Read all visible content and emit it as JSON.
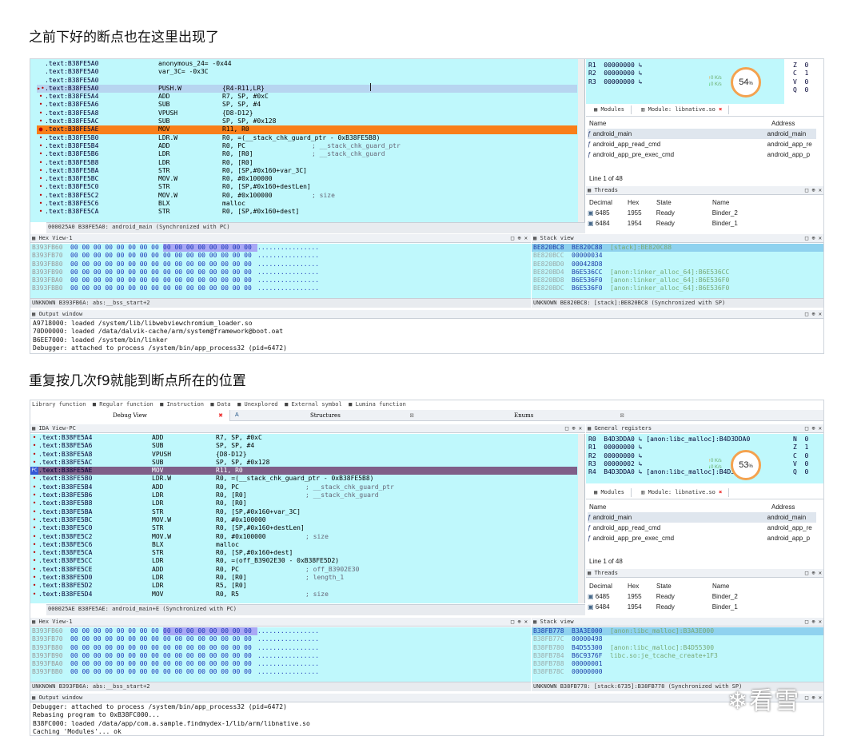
{
  "heading1": "之前下好的断点也在这里出现了",
  "heading2": "重复按几次f9就能到断点所在的位置",
  "watermark": "看雪",
  "shot1": {
    "ida_rows": [
      {
        "m": "",
        "a": ".text:B38FE5A0",
        "op": "anonymous_24= -0x44",
        "arg": "",
        "cm": "",
        "hl": ""
      },
      {
        "m": "",
        "a": ".text:B38FE5A0",
        "op": "var_3C= -0x3C",
        "arg": "",
        "cm": "",
        "hl": ""
      },
      {
        "m": "",
        "a": ".text:B38FE5A0",
        "op": "",
        "arg": "",
        "cm": "",
        "hl": ""
      },
      {
        "m": "▸•",
        "a": ".text:B38FE5A0",
        "op": "PUSH.W",
        "arg": "{R4-R11,LR}",
        "cm": "",
        "hl": "blue"
      },
      {
        "m": "•",
        "a": ".text:B38FE5A4",
        "op": "ADD",
        "arg": "R7, SP, #0xC",
        "cm": "",
        "hl": ""
      },
      {
        "m": "•",
        "a": ".text:B38FE5A6",
        "op": "SUB",
        "arg": "SP, SP, #4",
        "cm": "",
        "hl": ""
      },
      {
        "m": "•",
        "a": ".text:B38FE5A8",
        "op": "VPUSH",
        "arg": "{D8-D12}",
        "cm": "",
        "hl": ""
      },
      {
        "m": "•",
        "a": ".text:B38FE5AC",
        "op": "SUB",
        "arg": "SP, SP, #0x128",
        "cm": "",
        "hl": ""
      },
      {
        "m": "●",
        "a": ".text:B38FE5AE",
        "op": "MOV",
        "arg": "R11, R0",
        "cm": "",
        "hl": "orange"
      },
      {
        "m": "•",
        "a": ".text:B38FE5B0",
        "op": "LDR.W",
        "arg": "R0, =(__stack_chk_guard_ptr - 0xB38FE5B8)",
        "cm": "",
        "hl": ""
      },
      {
        "m": "•",
        "a": ".text:B38FE5B4",
        "op": "ADD",
        "arg": "R0, PC",
        "cm": "; __stack_chk_guard_ptr",
        "hl": ""
      },
      {
        "m": "•",
        "a": ".text:B38FE5B6",
        "op": "LDR",
        "arg": "R0, [R0]",
        "cm": "; __stack_chk_guard",
        "hl": ""
      },
      {
        "m": "•",
        "a": ".text:B38FE5B8",
        "op": "LDR",
        "arg": "R0, [R0]",
        "cm": "",
        "hl": ""
      },
      {
        "m": "•",
        "a": ".text:B38FE5BA",
        "op": "STR",
        "arg": "R0, [SP,#0x160+var_3C]",
        "cm": "",
        "hl": ""
      },
      {
        "m": "•",
        "a": ".text:B38FE5BC",
        "op": "MOV.W",
        "arg": "R0, #0x100000",
        "cm": "",
        "hl": ""
      },
      {
        "m": "•",
        "a": ".text:B38FE5C0",
        "op": "STR",
        "arg": "R0, [SP,#0x160+destLen]",
        "cm": "",
        "hl": ""
      },
      {
        "m": "•",
        "a": ".text:B38FE5C2",
        "op": "MOV.W",
        "arg": "R0, #0x100000",
        "cm": "; size",
        "hl": ""
      },
      {
        "m": "•",
        "a": ".text:B38FE5C6",
        "op": "BLX",
        "arg": "malloc",
        "cm": "",
        "hl": ""
      },
      {
        "m": "•",
        "a": ".text:B38FE5CA",
        "op": "STR",
        "arg": "R0, [SP,#0x160+dest]",
        "cm": "",
        "hl": ""
      }
    ],
    "ida_status": "000025A0 B38FE5A0: android_main (Synchronized with PC)",
    "regs": [
      "R1  00000000 ↳",
      "R2  00000000 ↳",
      "R3  00000000 ↳"
    ],
    "flags": [
      "Z  0",
      "C  1",
      "V  0",
      "Q  0"
    ],
    "gauge": "54",
    "gauge_unit": "%",
    "speed_up": "0 K/s",
    "speed_down": "0 K/s",
    "tabs": [
      "Modules",
      "Module: libnative.so"
    ],
    "mod_headers": [
      "Name",
      "Address"
    ],
    "mod_rows": [
      [
        "android_main",
        "android_main"
      ],
      [
        "android_app_read_cmd",
        "android_app_re"
      ],
      [
        "android_app_pre_exec_cmd",
        "android_app_p"
      ]
    ],
    "line_info": "Line 1 of 48",
    "threads_title": "Threads",
    "thr_headers": [
      "Decimal",
      "Hex",
      "State",
      "Name"
    ],
    "thr_rows": [
      [
        "6485",
        "1955",
        "Ready",
        "Binder_2"
      ],
      [
        "6484",
        "1954",
        "Ready",
        "Binder_1"
      ]
    ],
    "hex_title": "Hex View-1",
    "hex_rows": [
      {
        "addr": "B393FB60",
        "a": "00 00 00 00 00 00 00 00",
        "b": "00 00 00 00 00 00 00 00",
        "s": "................"
      },
      {
        "addr": "B393FB70",
        "a": "00 00 00 00 00 00 00 00",
        "b": "00 00 00 00 00 00 00 00",
        "s": "................"
      },
      {
        "addr": "B393FB80",
        "a": "00 00 00 00 00 00 00 00",
        "b": "00 00 00 00 00 00 00 00",
        "s": "................"
      },
      {
        "addr": "B393FB90",
        "a": "00 00 00 00 00 00 00 00",
        "b": "00 00 00 00 00 00 00 00",
        "s": "................"
      },
      {
        "addr": "B393FBA0",
        "a": "00 00 00 00 00 00 00 00",
        "b": "00 00 00 00 00 00 00 00",
        "s": "................"
      },
      {
        "addr": "B393FBB0",
        "a": "00 00 00 00 00 00 00 00",
        "b": "00 00 00 00 00 00 00 00",
        "s": "................"
      }
    ],
    "hex_status": "UNKNOWN B393FB6A: abs:__bss_start+2",
    "stack_title": "Stack view",
    "stack_rows": [
      {
        "a": "BE820BC8",
        "v": "BE820C88",
        "c": "[stack]:BE820C88",
        "sel": true
      },
      {
        "a": "BE820BCC",
        "v": "00000034",
        "c": "",
        "sel": false
      },
      {
        "a": "BE820BD0",
        "v": "000428D8",
        "c": "",
        "sel": false
      },
      {
        "a": "BE820BD4",
        "v": "B6E536CC",
        "c": "[anon:linker_alloc_64]:B6E536CC",
        "sel": false
      },
      {
        "a": "BE820BD8",
        "v": "B6E536F0",
        "c": "[anon:linker_alloc_64]:B6E536F0",
        "sel": false
      },
      {
        "a": "BE820BDC",
        "v": "B6E536F0",
        "c": "[anon:linker_alloc_64]:B6E536F0",
        "sel": false
      }
    ],
    "stack_status": "UNKNOWN BE820BC8: [stack]:BE820BC8 (Synchronized with SP)",
    "output_title": "Output window",
    "output_lines": [
      "A9718000: loaded /system/lib/libwebviewchromium_loader.so",
      "70D00000: loaded /data/dalvik-cache/arm/system@framework@boot.oat",
      "B6EE7000: loaded /system/bin/linker",
      "Debugger: attached to process /system/bin/app_process32 (pid=6472)"
    ]
  },
  "shot2": {
    "legend": "Library function  ■ Regular function  ■ Instruction  ■ Data  ■ Unexplored  ■ External symbol  ■ Lumina function",
    "top_tabs": [
      "Debug View",
      "A",
      "Structures",
      "Enums"
    ],
    "ida_title": "IDA View-PC",
    "ida_rows": [
      {
        "m": "•",
        "a": ".text:B38FE5A4",
        "op": "ADD",
        "arg": "R7, SP, #0xC",
        "cm": "",
        "hl": ""
      },
      {
        "m": "•",
        "a": ".text:B38FE5A6",
        "op": "SUB",
        "arg": "SP, SP, #4",
        "cm": "",
        "hl": ""
      },
      {
        "m": "•",
        "a": ".text:B38FE5A8",
        "op": "VPUSH",
        "arg": "{D8-D12}",
        "cm": "",
        "hl": ""
      },
      {
        "m": "•",
        "a": ".text:B38FE5AC",
        "op": "SUB",
        "arg": "SP, SP, #0x128",
        "cm": "",
        "hl": ""
      },
      {
        "m": "PC",
        "a": ".text:B38FE5AE",
        "op": "MOV",
        "arg": "R11, R0",
        "cm": "",
        "hl": "purple"
      },
      {
        "m": "•",
        "a": ".text:B38FE5B0",
        "op": "LDR.W",
        "arg": "R0, =(__stack_chk_guard_ptr - 0xB38FE5B8)",
        "cm": "",
        "hl": ""
      },
      {
        "m": "•",
        "a": ".text:B38FE5B4",
        "op": "ADD",
        "arg": "R0, PC",
        "cm": "; __stack_chk_guard_ptr",
        "hl": ""
      },
      {
        "m": "•",
        "a": ".text:B38FE5B6",
        "op": "LDR",
        "arg": "R0, [R0]",
        "cm": "; __stack_chk_guard",
        "hl": ""
      },
      {
        "m": "•",
        "a": ".text:B38FE5B8",
        "op": "LDR",
        "arg": "R0, [R0]",
        "cm": "",
        "hl": ""
      },
      {
        "m": "•",
        "a": ".text:B38FE5BA",
        "op": "STR",
        "arg": "R0, [SP,#0x160+var_3C]",
        "cm": "",
        "hl": ""
      },
      {
        "m": "•",
        "a": ".text:B38FE5BC",
        "op": "MOV.W",
        "arg": "R0, #0x100000",
        "cm": "",
        "hl": ""
      },
      {
        "m": "•",
        "a": ".text:B38FE5C0",
        "op": "STR",
        "arg": "R0, [SP,#0x160+destLen]",
        "cm": "",
        "hl": ""
      },
      {
        "m": "•",
        "a": ".text:B38FE5C2",
        "op": "MOV.W",
        "arg": "R0, #0x100000",
        "cm": "; size",
        "hl": ""
      },
      {
        "m": "•",
        "a": ".text:B38FE5C6",
        "op": "BLX",
        "arg": "malloc",
        "cm": "",
        "hl": ""
      },
      {
        "m": "•",
        "a": ".text:B38FE5CA",
        "op": "STR",
        "arg": "R0, [SP,#0x160+dest]",
        "cm": "",
        "hl": ""
      },
      {
        "m": "•",
        "a": ".text:B38FE5CC",
        "op": "LDR",
        "arg": "R0, =(off_B3902E30 - 0xB38FE5D2)",
        "cm": "",
        "hl": ""
      },
      {
        "m": "•",
        "a": ".text:B38FE5CE",
        "op": "ADD",
        "arg": "R0, PC",
        "cm": "; off_B3902E30",
        "hl": ""
      },
      {
        "m": "•",
        "a": ".text:B38FE5D0",
        "op": "LDR",
        "arg": "R0, [R0]",
        "cm": "; length_1",
        "hl": ""
      },
      {
        "m": "•",
        "a": ".text:B38FE5D2",
        "op": "LDR",
        "arg": "R5, [R0]",
        "cm": "",
        "hl": ""
      },
      {
        "m": "•",
        "a": ".text:B38FE5D4",
        "op": "MOV",
        "arg": "R0, R5",
        "cm": "; size",
        "hl": ""
      }
    ],
    "ida_status": "000025AE B38FE5AE: android_main+E (Synchronized with PC)",
    "regs_title": "General registers",
    "regs": [
      "R0  B4D3DDA0 ↳ [anon:libc_malloc]:B4D3DDA0",
      "R1  00000000 ↳",
      "R2  00000000 ↳",
      "R3  00000002 ↳",
      "R4  B4D3DDA0 ↳ [anon:libc_malloc]:B4D3DDA0"
    ],
    "flags": [
      "N  0",
      "Z  1",
      "C  0",
      "V  0",
      "Q  0"
    ],
    "gauge": "53",
    "gauge_unit": "%",
    "speed_up": "0 K/s",
    "speed_down": "0 K/s",
    "tabs": [
      "Modules",
      "Module: libnative.so"
    ],
    "mod_headers": [
      "Name",
      "Address"
    ],
    "mod_rows": [
      [
        "android_main",
        "android_main"
      ],
      [
        "android_app_read_cmd",
        "android_app_re"
      ],
      [
        "android_app_pre_exec_cmd",
        "android_app_p"
      ]
    ],
    "line_info": "Line 1 of 48",
    "threads_title": "Threads",
    "thr_headers": [
      "Decimal",
      "Hex",
      "State",
      "Name"
    ],
    "thr_rows": [
      [
        "6485",
        "1955",
        "Ready",
        "Binder_2"
      ],
      [
        "6484",
        "1954",
        "Ready",
        "Binder_1"
      ]
    ],
    "hex_title": "Hex View-1",
    "hex_rows": [
      {
        "addr": "B393FB60",
        "a": "00 00 00 00 00 00 00 00",
        "b": "00 00 00 00 00 00 00 00",
        "s": "................"
      },
      {
        "addr": "B393FB70",
        "a": "00 00 00 00 00 00 00 00",
        "b": "00 00 00 00 00 00 00 00",
        "s": "................"
      },
      {
        "addr": "B393FB80",
        "a": "00 00 00 00 00 00 00 00",
        "b": "00 00 00 00 00 00 00 00",
        "s": "................"
      },
      {
        "addr": "B393FB90",
        "a": "00 00 00 00 00 00 00 00",
        "b": "00 00 00 00 00 00 00 00",
        "s": "................"
      },
      {
        "addr": "B393FBA0",
        "a": "00 00 00 00 00 00 00 00",
        "b": "00 00 00 00 00 00 00 00",
        "s": "................"
      },
      {
        "addr": "B393FBB0",
        "a": "00 00 00 00 00 00 00 00",
        "b": "00 00 00 00 00 00 00 00",
        "s": "................"
      }
    ],
    "hex_status": "UNKNOWN B393FB6A: abs:__bss_start+2",
    "stack_title": "Stack view",
    "stack_rows": [
      {
        "a": "B38FB778",
        "v": "B3A3E000",
        "c": "[anon:libc_malloc]:B3A3E000",
        "sel": true
      },
      {
        "a": "B38FB77C",
        "v": "00000498",
        "c": "",
        "sel": false
      },
      {
        "a": "B38FB780",
        "v": "B4D55300",
        "c": "[anon:libc_malloc]:B4D55300",
        "sel": false
      },
      {
        "a": "B38FB784",
        "v": "B6C9376F",
        "c": "libc.so:je_tcache_create+1F3",
        "sel": false
      },
      {
        "a": "B38FB788",
        "v": "00000001",
        "c": "",
        "sel": false
      },
      {
        "a": "B38FB78C",
        "v": "00000000",
        "c": "",
        "sel": false
      }
    ],
    "stack_status": "UNKNOWN B38FB778: [stack:6735]:B38FB778 (Synchronized with SP)",
    "output_title": "Output window",
    "output_lines": [
      "Debugger: attached to process /system/bin/app_process32 (pid=6472)",
      "Rebasing program to 0xB38FC000...",
      "B38FC000: loaded /data/app/com.a.sample.findmydex-1/lib/arm/libnative.so",
      "Caching 'Modules'... ok"
    ]
  }
}
